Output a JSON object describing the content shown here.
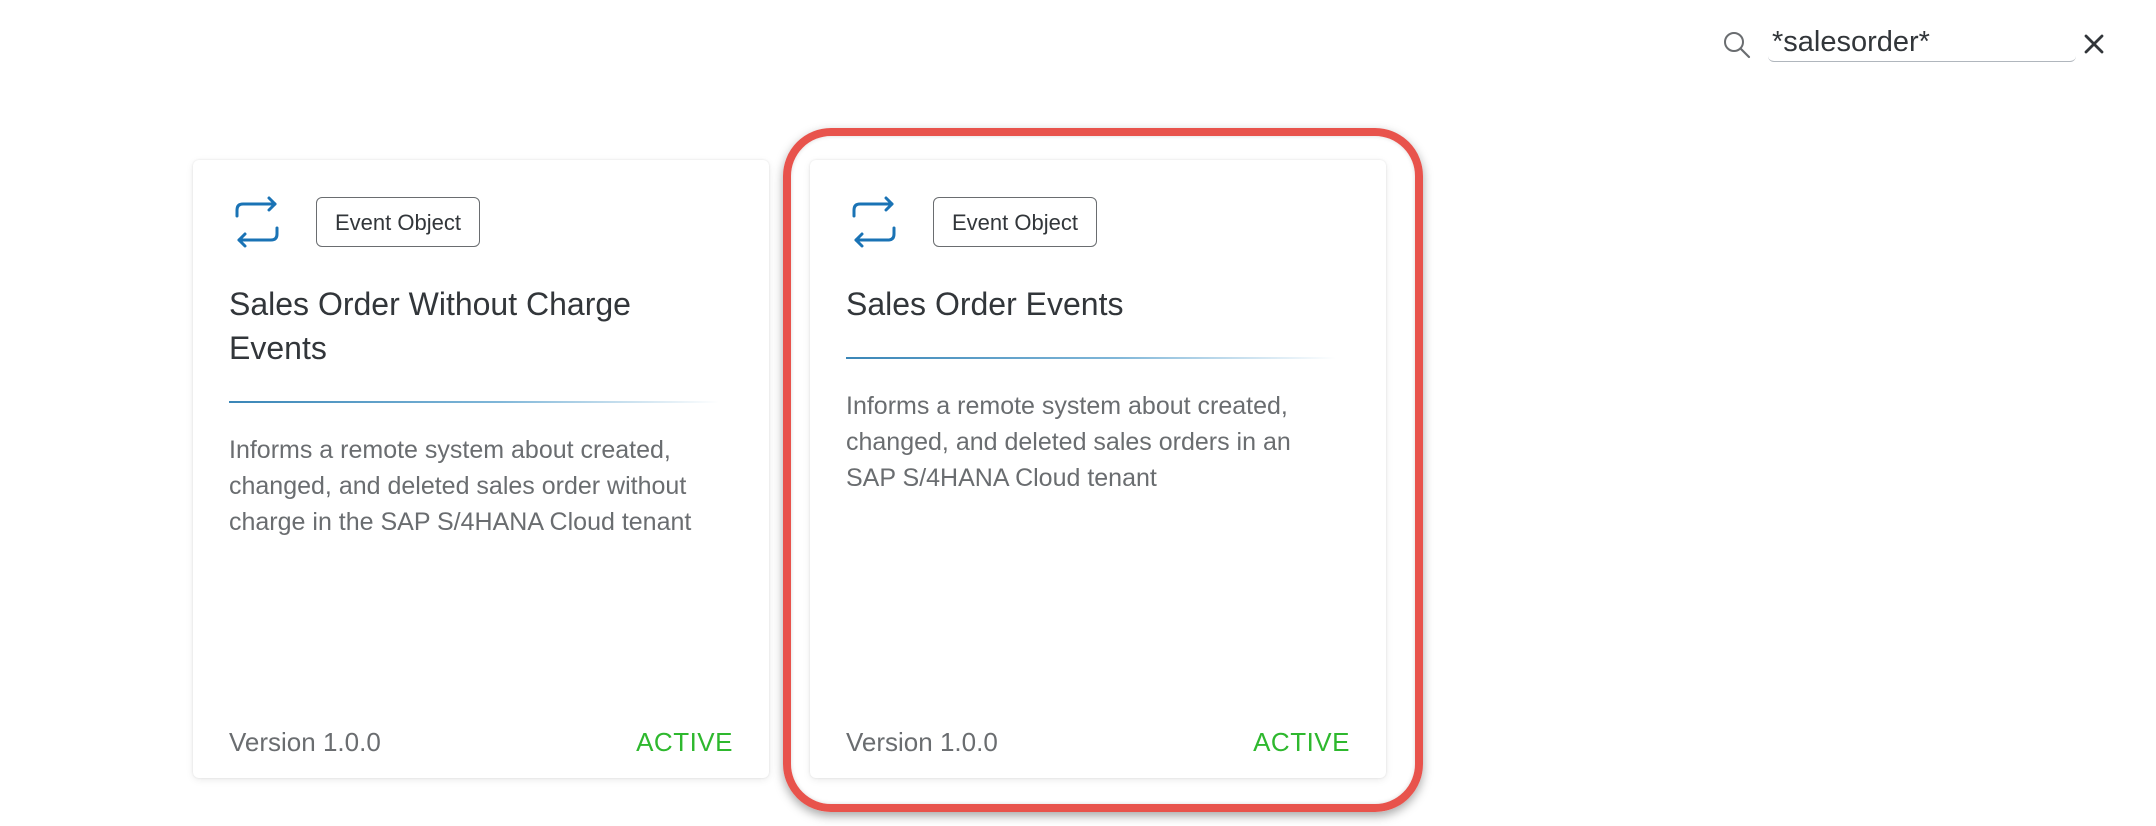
{
  "search": {
    "value": "*salesorder*",
    "icon": "search-icon",
    "clear_icon": "close-icon"
  },
  "cards": [
    {
      "icon": "sync-arrows-icon",
      "tag": "Event Object",
      "title": "Sales Order Without Charge Events",
      "description": "Informs a remote system about created, changed, and deleted sales order without charge in the SAP S/4HANA Cloud tenant",
      "version": "Version 1.0.0",
      "status": "ACTIVE"
    },
    {
      "icon": "sync-arrows-icon",
      "tag": "Event Object",
      "title": "Sales Order Events",
      "description": "Informs a remote system about created, changed, and deleted sales orders in an SAP S/4HANA Cloud tenant",
      "version": "Version 1.0.0",
      "status": "ACTIVE",
      "highlighted": true
    }
  ],
  "colors": {
    "accent": "#1a73b5",
    "status_active": "#2eb82e",
    "highlight": "#e8534c",
    "text_primary": "#32363a",
    "text_secondary": "#6a6d70"
  }
}
